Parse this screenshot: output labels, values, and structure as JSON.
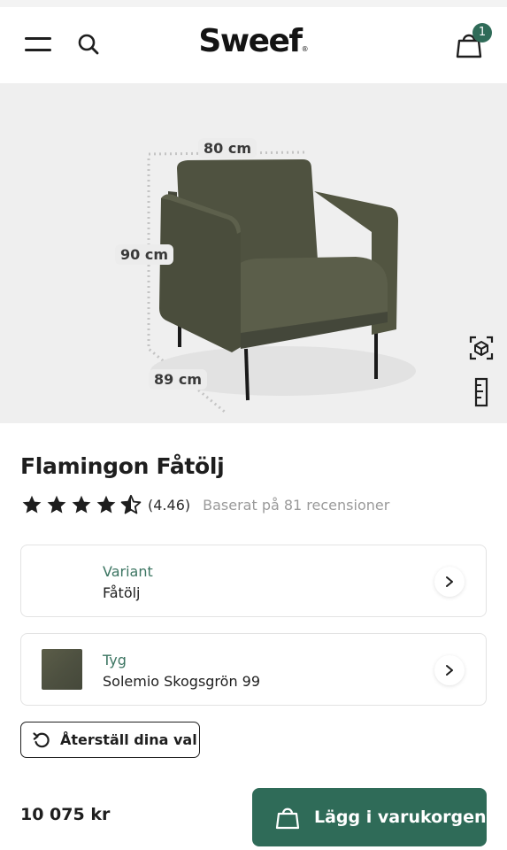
{
  "header": {
    "logo_text": "Sweef",
    "logo_mark": "®",
    "cart_count": "1",
    "icons": [
      "menu-icon",
      "search-icon",
      "bag-icon"
    ]
  },
  "hero": {
    "dim_width": "80 cm",
    "dim_height": "90 cm",
    "dim_depth": "89 cm",
    "icons": [
      "ar-cube-icon",
      "ruler-icon"
    ]
  },
  "product": {
    "title": "Flamingon Fåtölj",
    "rating_value": "(4.46)",
    "rating_stars": 4.46,
    "rating_count_text": "Baserat på 81 recensioner"
  },
  "options": {
    "variant": {
      "label": "Variant",
      "value": "Fåtölj"
    },
    "fabric": {
      "label": "Tyg",
      "value": "Solemio Skogsgrön 99"
    }
  },
  "actions": {
    "reset_label": "Återställ dina val",
    "add_to_cart_label": "Lägg i varukorgen"
  },
  "price": "10 075 kr",
  "colors": {
    "brand_green": "#2f6b58",
    "label_green": "#3c7562",
    "fabric_swatch": "#4f5242"
  }
}
